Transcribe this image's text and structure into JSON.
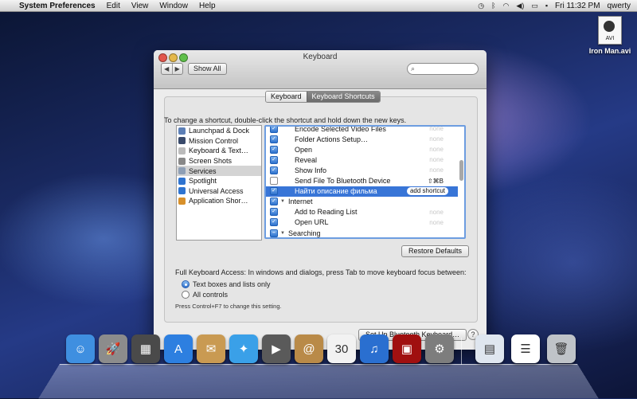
{
  "menubar": {
    "app_name": "System Preferences",
    "menus": [
      "Edit",
      "View",
      "Window",
      "Help"
    ],
    "clock": "Fri 11:32 PM",
    "user": "qwerty"
  },
  "desktop": {
    "file_name": "Iron Man.avi",
    "file_badge": "AVI"
  },
  "window": {
    "title": "Keyboard",
    "show_all": "Show All",
    "search_placeholder": "",
    "tabs": [
      "Keyboard",
      "Keyboard Shortcuts"
    ],
    "selected_tab": "Keyboard Shortcuts",
    "instructions": "To change a shortcut, double-click the shortcut and hold down the new keys.",
    "categories": [
      {
        "label": "Launchpad & Dock",
        "icon": "launchpad-icon",
        "color": "#5c7fb6"
      },
      {
        "label": "Mission Control",
        "icon": "mission-control-icon",
        "color": "#394a6b"
      },
      {
        "label": "Keyboard & Text…",
        "icon": "keyboard-icon",
        "color": "#bbbbbb"
      },
      {
        "label": "Screen Shots",
        "icon": "camera-icon",
        "color": "#888888"
      },
      {
        "label": "Services",
        "icon": "gear-icon",
        "color": "#8e9fb5"
      },
      {
        "label": "Spotlight",
        "icon": "spotlight-icon",
        "color": "#2f74d0"
      },
      {
        "label": "Universal Access",
        "icon": "universal-access-icon",
        "color": "#2f74d0"
      },
      {
        "label": "Application Shor…",
        "icon": "app-store-icon",
        "color": "#d8902a"
      }
    ],
    "selected_category": "Services",
    "shortcuts": [
      {
        "label": "Encode Selected Video Files",
        "key": "none",
        "check": "on",
        "type": "item"
      },
      {
        "label": "Folder Actions Setup…",
        "key": "none",
        "check": "on",
        "type": "item"
      },
      {
        "label": "Open",
        "key": "none",
        "check": "on",
        "type": "item"
      },
      {
        "label": "Reveal",
        "key": "none",
        "check": "on",
        "type": "item"
      },
      {
        "label": "Show Info",
        "key": "none",
        "check": "on",
        "type": "item"
      },
      {
        "label": "Send File To Bluetooth Device",
        "key": "⇧⌘B",
        "check": "off",
        "type": "item"
      },
      {
        "label": "Найти описание фильма",
        "key": "add shortcut",
        "check": "on",
        "type": "item",
        "selected": true
      },
      {
        "label": "Internet",
        "key": "",
        "check": "on",
        "type": "group"
      },
      {
        "label": "Add to Reading List",
        "key": "none",
        "check": "on",
        "type": "item"
      },
      {
        "label": "Open URL",
        "key": "none",
        "check": "on",
        "type": "item"
      },
      {
        "label": "Searching",
        "key": "",
        "check": "mixed",
        "type": "group"
      }
    ],
    "restore_defaults": "Restore Defaults",
    "full_keyboard_access": "Full Keyboard Access: In windows and dialogs, press Tab to move keyboard focus between:",
    "radio_text_boxes": "Text boxes and lists only",
    "radio_all_controls": "All controls",
    "radio_selected": "Text boxes and lists only",
    "hint": "Press Control+F7 to change this setting.",
    "bluetooth_button": "Set Up Bluetooth Keyboard…",
    "help": "?"
  },
  "dock": {
    "items": [
      {
        "name": "finder-icon",
        "color": "#3f8fe0",
        "glyph": "☺"
      },
      {
        "name": "launchpad-icon",
        "color": "#8c8c8c",
        "glyph": "🚀"
      },
      {
        "name": "mission-control-icon",
        "color": "#4a4a4a",
        "glyph": "▦"
      },
      {
        "name": "app-store-icon",
        "color": "#2d7fe0",
        "glyph": "A"
      },
      {
        "name": "mail-stamp-icon",
        "color": "#c99a52",
        "glyph": "✉"
      },
      {
        "name": "safari-icon",
        "color": "#3aa0e8",
        "glyph": "✦"
      },
      {
        "name": "facetime-icon",
        "color": "#5a5a5a",
        "glyph": "▶"
      },
      {
        "name": "address-book-icon",
        "color": "#b98a48",
        "glyph": "@"
      },
      {
        "name": "ical-icon",
        "color": "#f2f2f2",
        "glyph": "30"
      },
      {
        "name": "itunes-icon",
        "color": "#2a6fd0",
        "glyph": "♫"
      },
      {
        "name": "photo-booth-icon",
        "color": "#a01010",
        "glyph": "▣"
      },
      {
        "name": "system-preferences-icon",
        "color": "#7d7d7d",
        "glyph": "⚙"
      },
      {
        "name": "preview-icon",
        "color": "#dfe6ef",
        "glyph": "▤"
      },
      {
        "name": "document-icon",
        "color": "#ffffff",
        "glyph": "☰"
      },
      {
        "name": "trash-icon",
        "color": "#bfc3c8",
        "glyph": "🗑"
      }
    ]
  }
}
